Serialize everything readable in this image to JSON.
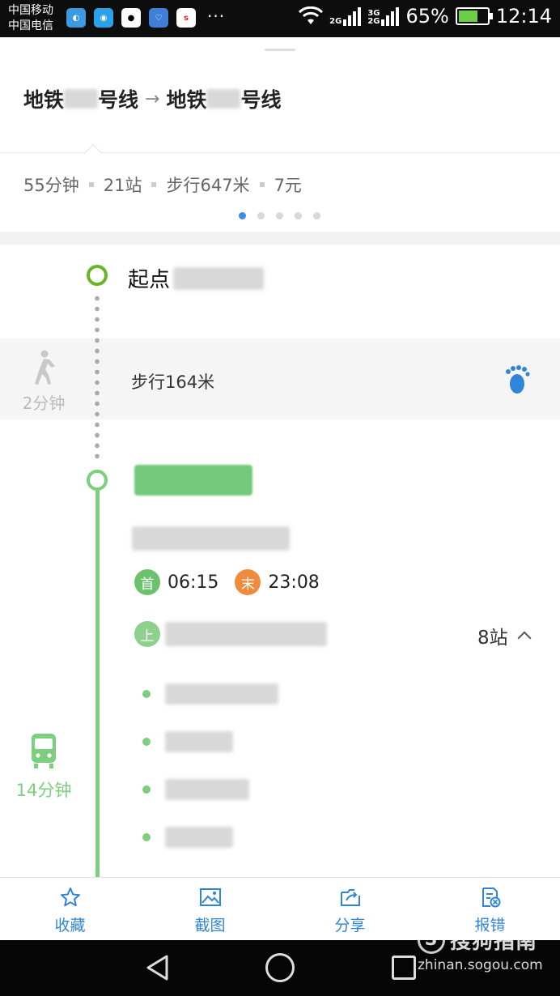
{
  "status_bar": {
    "carrier1": "中国移动",
    "carrier2": "中国电信",
    "more": "···",
    "net1": "2G",
    "net2a": "3G",
    "net2b": "2G",
    "battery": "65%",
    "time": "12:14",
    "app_icons": [
      "browser-icon",
      "map-pin-icon",
      "qq-icon",
      "health-icon",
      "sina-icon"
    ]
  },
  "route": {
    "from_prefix": "地铁",
    "from_suffix": "号线",
    "arrow": "→",
    "to_prefix": "地铁",
    "to_suffix": "号线"
  },
  "summary": {
    "duration": "55分钟",
    "stations": "21站",
    "walk": "步行647米",
    "fare": "7元",
    "page_count": 5,
    "active_page": 0
  },
  "steps": {
    "start_label": "起点",
    "walk_time": "2分钟",
    "walk_distance": "步行164米",
    "first_badge": "首",
    "first_time": "06:15",
    "last_badge": "末",
    "last_time": "23:08",
    "board_badge": "上",
    "stop_count": "8站",
    "ride_time": "14分钟"
  },
  "toolbar": {
    "favorite": "收藏",
    "screenshot": "截图",
    "share": "分享",
    "report": "报错"
  },
  "watermark": {
    "brand": "搜狗指南",
    "s": "S",
    "url": "zhinan.sogou.com"
  },
  "colors": {
    "accent_blue": "#2f86d6",
    "line_green": "#7bcf7e",
    "start_green": "#6bb624",
    "last_orange": "#f08a3c"
  }
}
